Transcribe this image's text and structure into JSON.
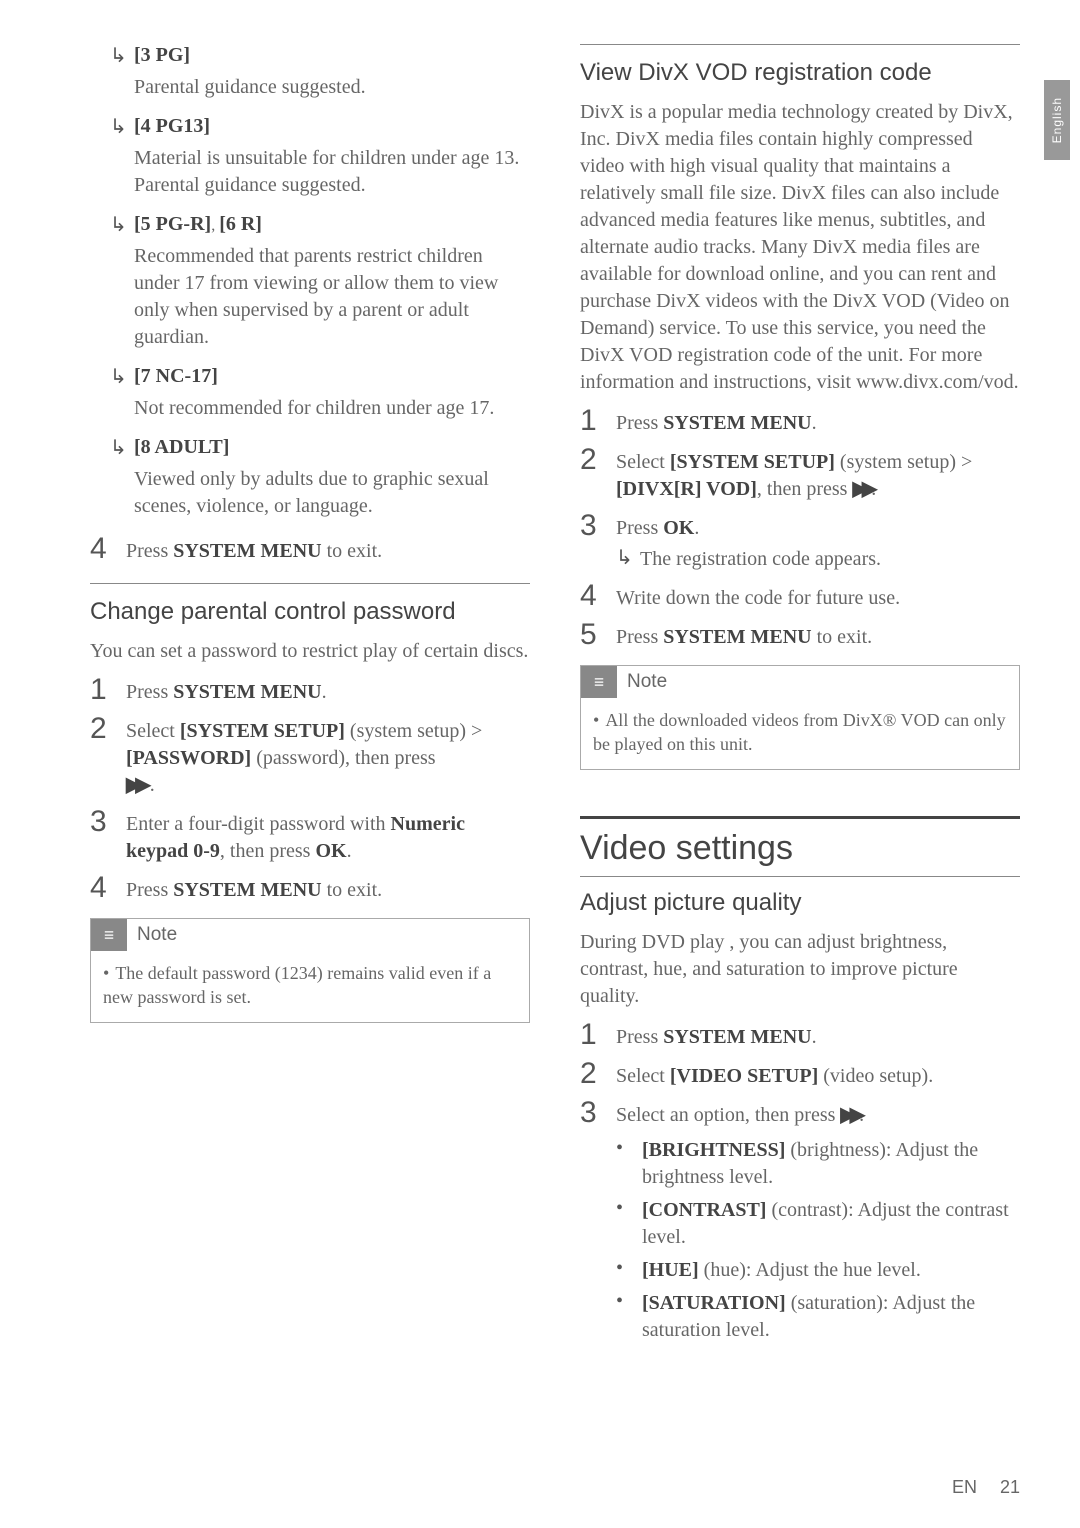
{
  "sideTab": "English",
  "leftCol": {
    "ratings": [
      {
        "label": "[3 PG]",
        "desc": "Parental guidance suggested."
      },
      {
        "label": "[4 PG13]",
        "desc": "Material is unsuitable for children under age 13. Parental guidance suggested."
      },
      {
        "labelCombo": {
          "a": "[5 PG-R]",
          "sep": ", ",
          "b": "[6 R]"
        },
        "desc": "Recommended that parents restrict children under 17 from viewing or allow them to view only when supervised by a parent or adult guardian."
      },
      {
        "label": "[7 NC-17]",
        "desc": "Not recommended for children under age 17."
      },
      {
        "label": "[8 ADULT]",
        "desc": "Viewed only by adults due to graphic sexual scenes, violence, or language."
      }
    ],
    "step4": {
      "num": "4",
      "pre": "Press ",
      "bold": "SYSTEM MENU",
      "post": " to exit."
    },
    "changePw": {
      "title": "Change parental control password",
      "intro": "You can set a password to restrict play of certain discs.",
      "steps": [
        {
          "num": "1",
          "pre": "Press ",
          "bold": "SYSTEM MENU",
          "post": "."
        },
        {
          "num": "2",
          "textParts": {
            "a": "Select ",
            "b": "[SYSTEM SETUP]",
            "c": " (system setup) > ",
            "d": "[PASSWORD]",
            "e": " (password), then press "
          },
          "ffwd": true,
          "tail": " ."
        },
        {
          "num": "3",
          "textParts": {
            "a": "Enter a four-digit password with ",
            "b": "Numeric keypad 0-9",
            "c": ", then press ",
            "d": "OK",
            "e": "."
          }
        },
        {
          "num": "4",
          "pre": "Press ",
          "bold": "SYSTEM MENU",
          "post": " to exit."
        }
      ],
      "note": {
        "label": "Note",
        "text": "The default password (1234) remains valid even if a new password is set."
      }
    }
  },
  "rightCol": {
    "divx": {
      "title": "View DivX VOD registration code",
      "body": "DivX is a popular media technology created by DivX, Inc. DivX media files contain highly compressed video with high visual quality that maintains a relatively small file size. DivX files can also include advanced media features like menus, subtitles, and alternate audio tracks. Many DivX media files are available for download online, and you can rent and purchase DivX videos with the DivX VOD (Video on Demand) service. To use this service, you need the DivX VOD registration code of the unit. For more information and instructions, visit www.divx.com/vod.",
      "steps": {
        "s1": {
          "num": "1",
          "pre": "Press ",
          "bold": "SYSTEM MENU",
          "post": "."
        },
        "s2": {
          "num": "2",
          "a": "Select ",
          "b": "[SYSTEM SETUP]",
          "c": " (system setup) > ",
          "d": "[DIVX[R] VOD]",
          "e": ", then press "
        },
        "s3": {
          "num": "3",
          "pre": "Press ",
          "bold": "OK",
          "post": ".",
          "sub": "The registration code appears."
        },
        "s4": {
          "num": "4",
          "text": "Write down the code for future use."
        },
        "s5": {
          "num": "5",
          "pre": "Press ",
          "bold": "SYSTEM MENU",
          "post": " to exit."
        }
      },
      "note": {
        "label": "Note",
        "text": "All the downloaded videos from DivX® VOD can only be played on this unit."
      }
    },
    "video": {
      "bigTitle": "Video settings",
      "adjust": {
        "title": "Adjust picture quality",
        "intro": "During DVD play , you can adjust brightness, contrast, hue, and saturation to improve picture quality.",
        "s1": {
          "num": "1",
          "pre": "Press ",
          "bold": "SYSTEM MENU",
          "post": "."
        },
        "s2": {
          "num": "2",
          "a": "Select ",
          "b": "[VIDEO SETUP]",
          "c": " (video setup)."
        },
        "s3": {
          "num": "3",
          "a": "Select an option, then press "
        },
        "bullets": [
          {
            "b": "[BRIGHTNESS]",
            "t": " (brightness): Adjust the brightness level."
          },
          {
            "b": "[CONTRAST]",
            "t": " (contrast): Adjust the contrast level."
          },
          {
            "b": "[HUE]",
            "t": " (hue): Adjust the hue level."
          },
          {
            "b": "[SATURATION]",
            "t": " (saturation): Adjust the saturation level."
          }
        ]
      }
    }
  },
  "footer": {
    "lang": "EN",
    "page": "21"
  }
}
